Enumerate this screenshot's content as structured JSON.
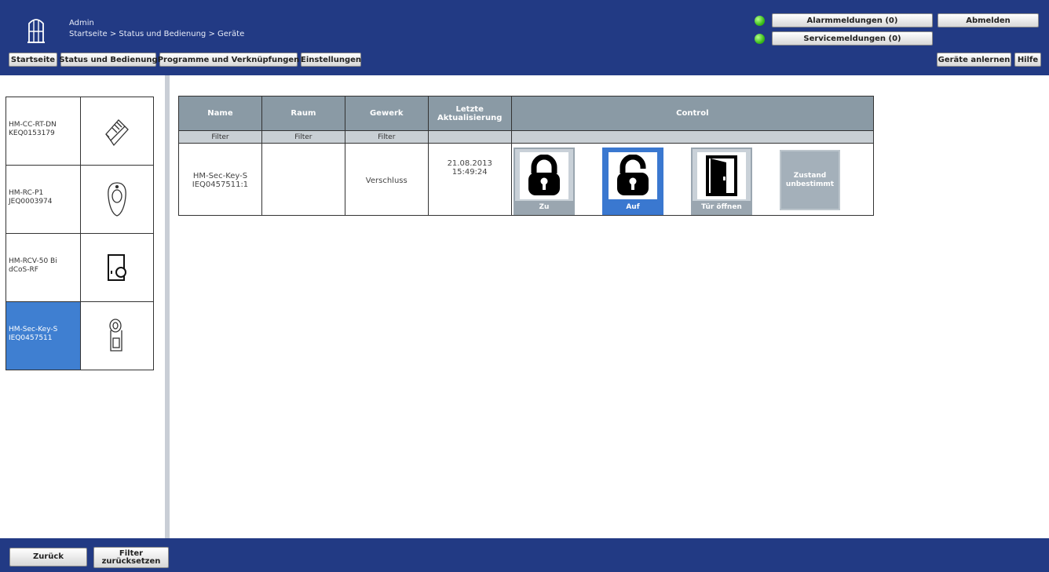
{
  "header": {
    "user": "Admin",
    "breadcrumb": "Startseite > Status und Bedienung > Geräte",
    "alarm_label": "Alarmmeldungen (0)",
    "service_label": "Servicemeldungen (0)",
    "logout_label": "Abmelden",
    "nav": [
      "Startseite",
      "Status und Bedienung",
      "Programme und Verknüpfungen",
      "Einstellungen"
    ],
    "learn_devices_label": "Geräte anlernen",
    "help_label": "Hilfe",
    "status_color": "#3bbf1a"
  },
  "devices": [
    {
      "line1": "HM-CC-RT-DN",
      "line2": "KEQ0153179",
      "icon": "thermostat-icon"
    },
    {
      "line1": "HM-RC-P1",
      "line2": "JEQ0003974",
      "icon": "remote-icon"
    },
    {
      "line1": "HM-RCV-50 Bi",
      "line2": "dCoS-RF",
      "icon": "virtual-remote-icon"
    },
    {
      "line1": "HM-Sec-Key-S",
      "line2": "IEQ0457511",
      "icon": "key-matic-icon",
      "selected": true
    }
  ],
  "table": {
    "headers": {
      "name": "Name",
      "room": "Raum",
      "trade": "Gewerk",
      "updated_1": "Letzte",
      "updated_2": "Aktualisierung",
      "control": "Control"
    },
    "filter_label": "Filter",
    "row": {
      "name_1": "HM-Sec-Key-S",
      "name_2": "IEQ0457511:1",
      "room": "",
      "trade": "Verschluss",
      "date": "21.08.2013",
      "time": "15:49:24"
    },
    "controls": {
      "lock": "Zu",
      "unlock": "Auf",
      "open": "Tür öffnen",
      "state_1": "Zustand",
      "state_2": "unbestimmt"
    }
  },
  "footer": {
    "back": "Zurück",
    "reset_1": "Filter",
    "reset_2": "zurücksetzen"
  },
  "colors": {
    "header_bg": "#223a84",
    "selected": "#3f7fd1",
    "table_header": "#8a9aa5"
  }
}
